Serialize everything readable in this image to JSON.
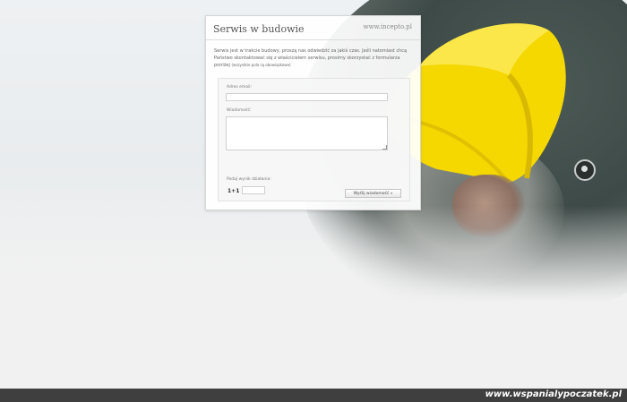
{
  "card": {
    "title": "Serwis w budowie",
    "site": "www.incepto.pl",
    "intro": "Serwis jest w trakcie budowy, proszą nas odwiedzić za jakiś czas. Jeśli natomiast chcą Państwo skontaktować się z właścicielem serwisu, prosimy skorzystać z formularza poniżej",
    "intro_note": "(wszystkie pola są obowiązkowe)"
  },
  "form": {
    "email_label": "Adres email:",
    "email_value": "",
    "message_label": "Wiadomość:",
    "message_value": "",
    "captcha_label": "Podaj wynik działania:",
    "captcha_question": "1+1",
    "captcha_value": "",
    "send_label": "Wyślij wiadomość »"
  },
  "footer": {
    "brand": "www.wspanialypoczatek.pl"
  },
  "colors": {
    "helmet": "#f5d800",
    "footer_bg": "#3f3f3f"
  }
}
